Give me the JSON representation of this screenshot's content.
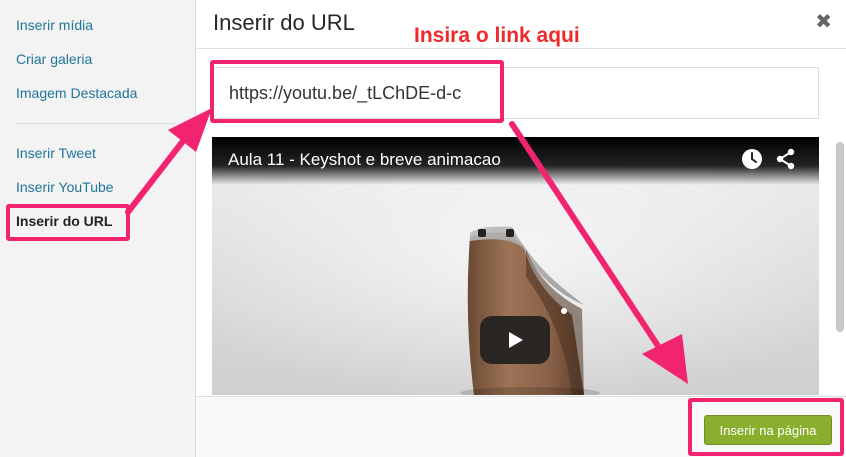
{
  "sidebar": {
    "items": [
      {
        "label": "Inserir mídia"
      },
      {
        "label": "Criar galeria"
      },
      {
        "label": "Imagem Destacada"
      },
      {
        "label": "Inserir Tweet"
      },
      {
        "label": "Inserir YouTube"
      },
      {
        "label": "Inserir do URL"
      }
    ],
    "active_item": "Inserir do URL"
  },
  "modal": {
    "title": "Inserir do URL",
    "close_icon": "close-icon",
    "url_value": "https://youtu.be/_tLChDE-d-c"
  },
  "annotation": {
    "text": "Insira o link aqui",
    "color": "#ee2a2a",
    "highlight_color": "#f2246f"
  },
  "video": {
    "title": "Aula 11 - Keyshot e breve animacao",
    "icons": [
      "clock-icon",
      "share-icon",
      "play-icon"
    ]
  },
  "footer": {
    "insert_label": "Inserir na página",
    "insert_color": "#8aaf2f"
  }
}
